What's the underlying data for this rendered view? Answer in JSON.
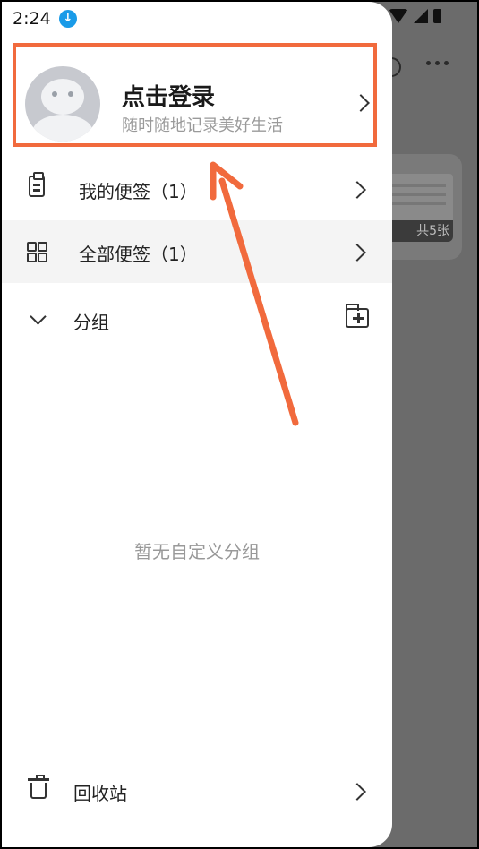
{
  "status_bar": {
    "time": "2:24",
    "download_glyph": "↓"
  },
  "profile": {
    "title": "点击登录",
    "subtitle": "随时随地记录美好生活"
  },
  "menu": [
    {
      "label": "我的便签（1）",
      "icon": "clipboard-icon"
    },
    {
      "label": "全部便签（1）",
      "icon": "grid-icon"
    }
  ],
  "group": {
    "label": "分组",
    "empty_text": "暂无自定义分组"
  },
  "recycle": {
    "label": "回收站",
    "icon": "trash-icon"
  },
  "background": {
    "card_count_text": "共5张"
  },
  "colors": {
    "highlight_box": "#f16a3d",
    "accent_blue": "#1a9be8"
  }
}
